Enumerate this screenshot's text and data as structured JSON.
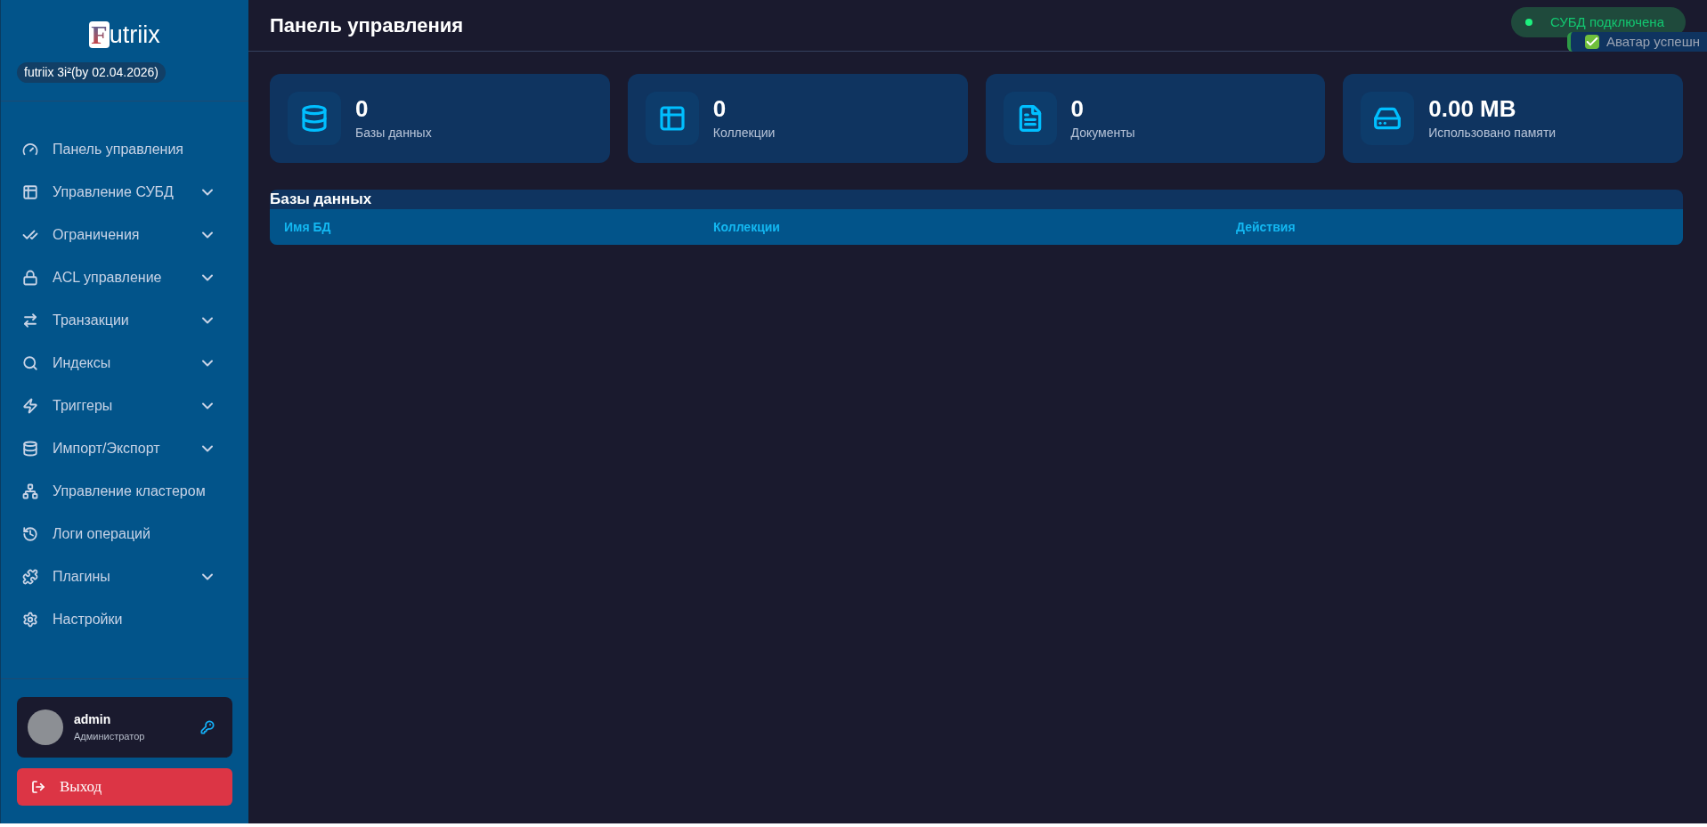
{
  "brand": {
    "logo_letter": "F",
    "logo_rest": "utriix",
    "version": "futriix 3i²(by 02.04.2026)"
  },
  "sidebar": {
    "items": [
      {
        "kind": "dashboard",
        "label": "Панель управления",
        "expandable": false
      },
      {
        "kind": "table",
        "label": "Управление СУБД",
        "expandable": true
      },
      {
        "kind": "checks",
        "label": "Ограничения",
        "expandable": true
      },
      {
        "kind": "lock",
        "label": "ACL управление",
        "expandable": true
      },
      {
        "kind": "swap",
        "label": "Транзакции",
        "expandable": true
      },
      {
        "kind": "search",
        "label": "Индексы",
        "expandable": true
      },
      {
        "kind": "bolt",
        "label": "Триггеры",
        "expandable": true
      },
      {
        "kind": "database",
        "label": "Импорт/Экспорт",
        "expandable": true
      },
      {
        "kind": "network",
        "label": "Управление кластером",
        "expandable": false
      },
      {
        "kind": "history",
        "label": "Логи операций",
        "expandable": false
      },
      {
        "kind": "puzzle",
        "label": "Плагины",
        "expandable": true
      },
      {
        "kind": "settings",
        "label": "Настройки",
        "expandable": false
      }
    ]
  },
  "user": {
    "name": "admin",
    "role": "Администратор"
  },
  "logout": {
    "label": "Выход"
  },
  "header": {
    "title": "Панель управления"
  },
  "toasts": [
    {
      "kind": "status",
      "text": "СУБД подключена"
    },
    {
      "kind": "success",
      "text": "Аватар успешн"
    }
  ],
  "stats": [
    {
      "kind": "database",
      "value": "0",
      "label": "Базы данных"
    },
    {
      "kind": "table",
      "value": "0",
      "label": "Коллекции"
    },
    {
      "kind": "file",
      "value": "0",
      "label": "Документы"
    },
    {
      "kind": "drive",
      "value": "0.00 MB",
      "label": "Использовано памяти"
    }
  ],
  "table": {
    "title": "Базы данных",
    "columns": [
      "Имя БД",
      "Коллекции",
      "Действия"
    ]
  }
}
